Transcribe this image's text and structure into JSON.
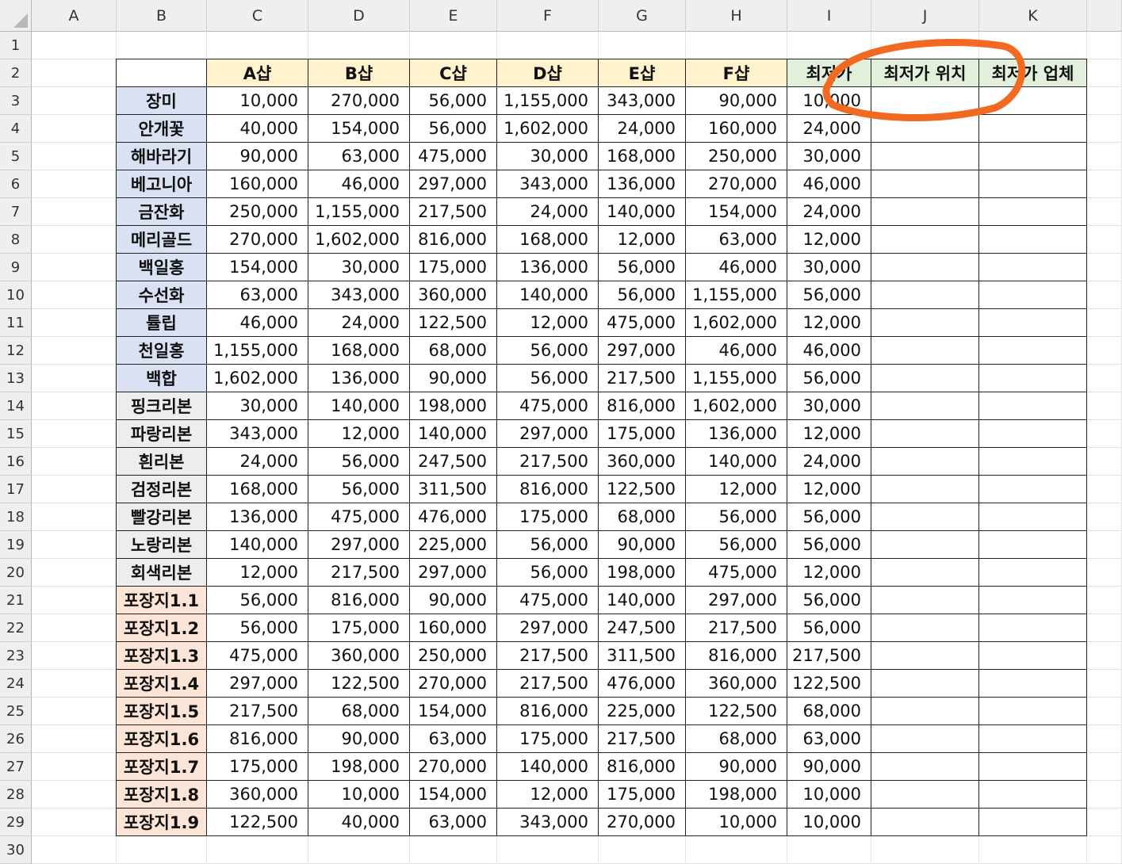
{
  "columns": [
    "A",
    "B",
    "C",
    "D",
    "E",
    "F",
    "G",
    "H",
    "I",
    "J",
    "K"
  ],
  "row_numbers": [
    "1",
    "2",
    "3",
    "4",
    "5",
    "6",
    "7",
    "8",
    "9",
    "10",
    "11",
    "12",
    "13",
    "14",
    "15",
    "16",
    "17",
    "18",
    "19",
    "20",
    "21",
    "22",
    "23",
    "24",
    "25",
    "26",
    "27",
    "28",
    "29",
    "30"
  ],
  "header_row": [
    "",
    "A샵",
    "B샵",
    "C샵",
    "D샵",
    "E샵",
    "F샵",
    "최저가",
    "최저가 위치",
    "최저가 업체"
  ],
  "colors": {
    "shop_header": "#fff2cc",
    "min_header": "#e2efda",
    "flower_label": "#d9e1f2",
    "ribbon_label": "#ededed",
    "wrapper_label": "#fce4d6",
    "highlight_ellipse": "#f26a21",
    "table_border": "#222222",
    "header_background": "#efefef"
  },
  "table_rows": [
    {
      "label": "장미",
      "group": "flower",
      "prices": [
        "10,000",
        "270,000",
        "56,000",
        "1,155,000",
        "343,000",
        "90,000"
      ],
      "min": "10,000"
    },
    {
      "label": "안개꽃",
      "group": "flower",
      "prices": [
        "40,000",
        "154,000",
        "56,000",
        "1,602,000",
        "24,000",
        "160,000"
      ],
      "min": "24,000"
    },
    {
      "label": "해바라기",
      "group": "flower",
      "prices": [
        "90,000",
        "63,000",
        "475,000",
        "30,000",
        "168,000",
        "250,000"
      ],
      "min": "30,000"
    },
    {
      "label": "베고니아",
      "group": "flower",
      "prices": [
        "160,000",
        "46,000",
        "297,000",
        "343,000",
        "136,000",
        "270,000"
      ],
      "min": "46,000"
    },
    {
      "label": "금잔화",
      "group": "flower",
      "prices": [
        "250,000",
        "1,155,000",
        "217,500",
        "24,000",
        "140,000",
        "154,000"
      ],
      "min": "24,000"
    },
    {
      "label": "메리골드",
      "group": "flower",
      "prices": [
        "270,000",
        "1,602,000",
        "816,000",
        "168,000",
        "12,000",
        "63,000"
      ],
      "min": "12,000"
    },
    {
      "label": "백일홍",
      "group": "flower",
      "prices": [
        "154,000",
        "30,000",
        "175,000",
        "136,000",
        "56,000",
        "46,000"
      ],
      "min": "30,000"
    },
    {
      "label": "수선화",
      "group": "flower",
      "prices": [
        "63,000",
        "343,000",
        "360,000",
        "140,000",
        "56,000",
        "1,155,000"
      ],
      "min": "56,000"
    },
    {
      "label": "튤립",
      "group": "flower",
      "prices": [
        "46,000",
        "24,000",
        "122,500",
        "12,000",
        "475,000",
        "1,602,000"
      ],
      "min": "12,000"
    },
    {
      "label": "천일홍",
      "group": "flower",
      "prices": [
        "1,155,000",
        "168,000",
        "68,000",
        "56,000",
        "297,000",
        "46,000"
      ],
      "min": "46,000"
    },
    {
      "label": "백합",
      "group": "flower",
      "prices": [
        "1,602,000",
        "136,000",
        "90,000",
        "56,000",
        "217,500",
        "1,155,000"
      ],
      "min": "56,000"
    },
    {
      "label": "핑크리본",
      "group": "ribbon",
      "prices": [
        "30,000",
        "140,000",
        "198,000",
        "475,000",
        "816,000",
        "1,602,000"
      ],
      "min": "30,000"
    },
    {
      "label": "파랑리본",
      "group": "ribbon",
      "prices": [
        "343,000",
        "12,000",
        "140,000",
        "297,000",
        "175,000",
        "136,000"
      ],
      "min": "12,000"
    },
    {
      "label": "흰리본",
      "group": "ribbon",
      "prices": [
        "24,000",
        "56,000",
        "247,500",
        "217,500",
        "360,000",
        "140,000"
      ],
      "min": "24,000"
    },
    {
      "label": "검정리본",
      "group": "ribbon",
      "prices": [
        "168,000",
        "56,000",
        "311,500",
        "816,000",
        "122,500",
        "12,000"
      ],
      "min": "12,000"
    },
    {
      "label": "빨강리본",
      "group": "ribbon",
      "prices": [
        "136,000",
        "475,000",
        "476,000",
        "175,000",
        "68,000",
        "56,000"
      ],
      "min": "56,000"
    },
    {
      "label": "노랑리본",
      "group": "ribbon",
      "prices": [
        "140,000",
        "297,000",
        "225,000",
        "56,000",
        "90,000",
        "56,000"
      ],
      "min": "56,000"
    },
    {
      "label": "회색리본",
      "group": "ribbon",
      "prices": [
        "12,000",
        "217,500",
        "297,000",
        "56,000",
        "198,000",
        "475,000"
      ],
      "min": "12,000"
    },
    {
      "label": "포장지1.1",
      "group": "wrapper",
      "prices": [
        "56,000",
        "816,000",
        "90,000",
        "475,000",
        "140,000",
        "297,000"
      ],
      "min": "56,000"
    },
    {
      "label": "포장지1.2",
      "group": "wrapper",
      "prices": [
        "56,000",
        "175,000",
        "160,000",
        "297,000",
        "247,500",
        "217,500"
      ],
      "min": "56,000"
    },
    {
      "label": "포장지1.3",
      "group": "wrapper",
      "prices": [
        "475,000",
        "360,000",
        "250,000",
        "217,500",
        "311,500",
        "816,000"
      ],
      "min": "217,500"
    },
    {
      "label": "포장지1.4",
      "group": "wrapper",
      "prices": [
        "297,000",
        "122,500",
        "270,000",
        "217,500",
        "476,000",
        "360,000"
      ],
      "min": "122,500"
    },
    {
      "label": "포장지1.5",
      "group": "wrapper",
      "prices": [
        "217,500",
        "68,000",
        "154,000",
        "816,000",
        "225,000",
        "122,500"
      ],
      "min": "68,000"
    },
    {
      "label": "포장지1.6",
      "group": "wrapper",
      "prices": [
        "816,000",
        "90,000",
        "63,000",
        "175,000",
        "217,500",
        "68,000"
      ],
      "min": "63,000"
    },
    {
      "label": "포장지1.7",
      "group": "wrapper",
      "prices": [
        "175,000",
        "198,000",
        "270,000",
        "140,000",
        "816,000",
        "90,000"
      ],
      "min": "90,000"
    },
    {
      "label": "포장지1.8",
      "group": "wrapper",
      "prices": [
        "360,000",
        "10,000",
        "154,000",
        "12,000",
        "175,000",
        "198,000"
      ],
      "min": "10,000"
    },
    {
      "label": "포장지1.9",
      "group": "wrapper",
      "prices": [
        "122,500",
        "40,000",
        "63,000",
        "343,000",
        "270,000",
        "10,000"
      ],
      "min": "10,000"
    }
  ]
}
